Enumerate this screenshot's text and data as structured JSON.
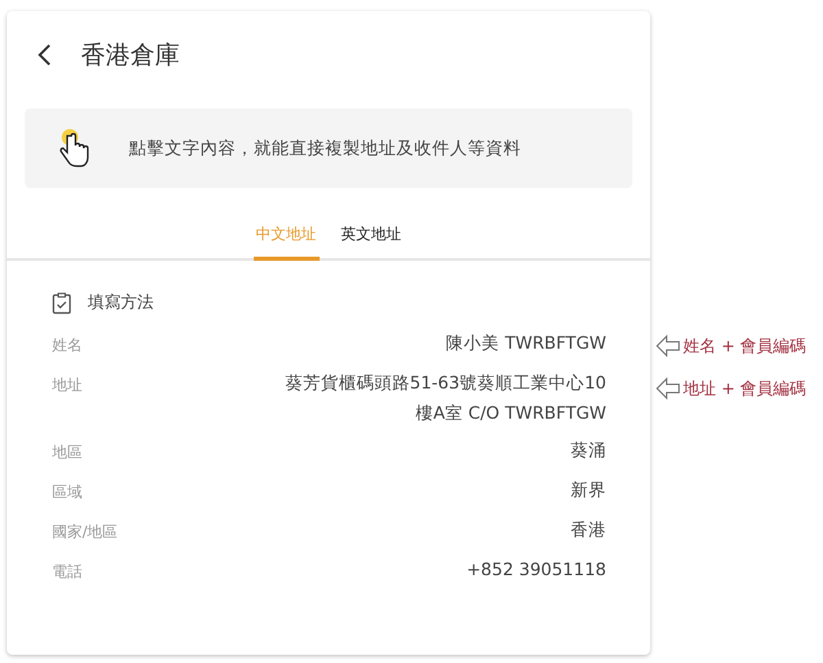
{
  "header": {
    "title": "香港倉庫"
  },
  "notice": {
    "text": "點擊文字內容，就能直接複製地址及收件人等資料"
  },
  "tabs": [
    {
      "label": "中文地址",
      "selected": true
    },
    {
      "label": "英文地址",
      "selected": false
    }
  ],
  "section": {
    "title": "填寫方法"
  },
  "fields": [
    {
      "label": "姓名",
      "value": [
        "陳小美 TWRBFTGW"
      ]
    },
    {
      "label": "地址",
      "value": [
        "葵芳貨櫃碼頭路51-63號葵順工業中心10",
        "樓A室 C/O TWRBFTGW"
      ]
    },
    {
      "label": "地區",
      "value": [
        "葵涌"
      ]
    },
    {
      "label": "區域",
      "value": [
        "新界"
      ]
    },
    {
      "label": "國家/地區",
      "value": [
        "香港"
      ]
    },
    {
      "label": "電話",
      "value": [
        "+852 39051118"
      ]
    }
  ],
  "annotations": [
    {
      "text": "姓名 + 會員編碼"
    },
    {
      "text": "地址 + 會員編碼"
    }
  ]
}
